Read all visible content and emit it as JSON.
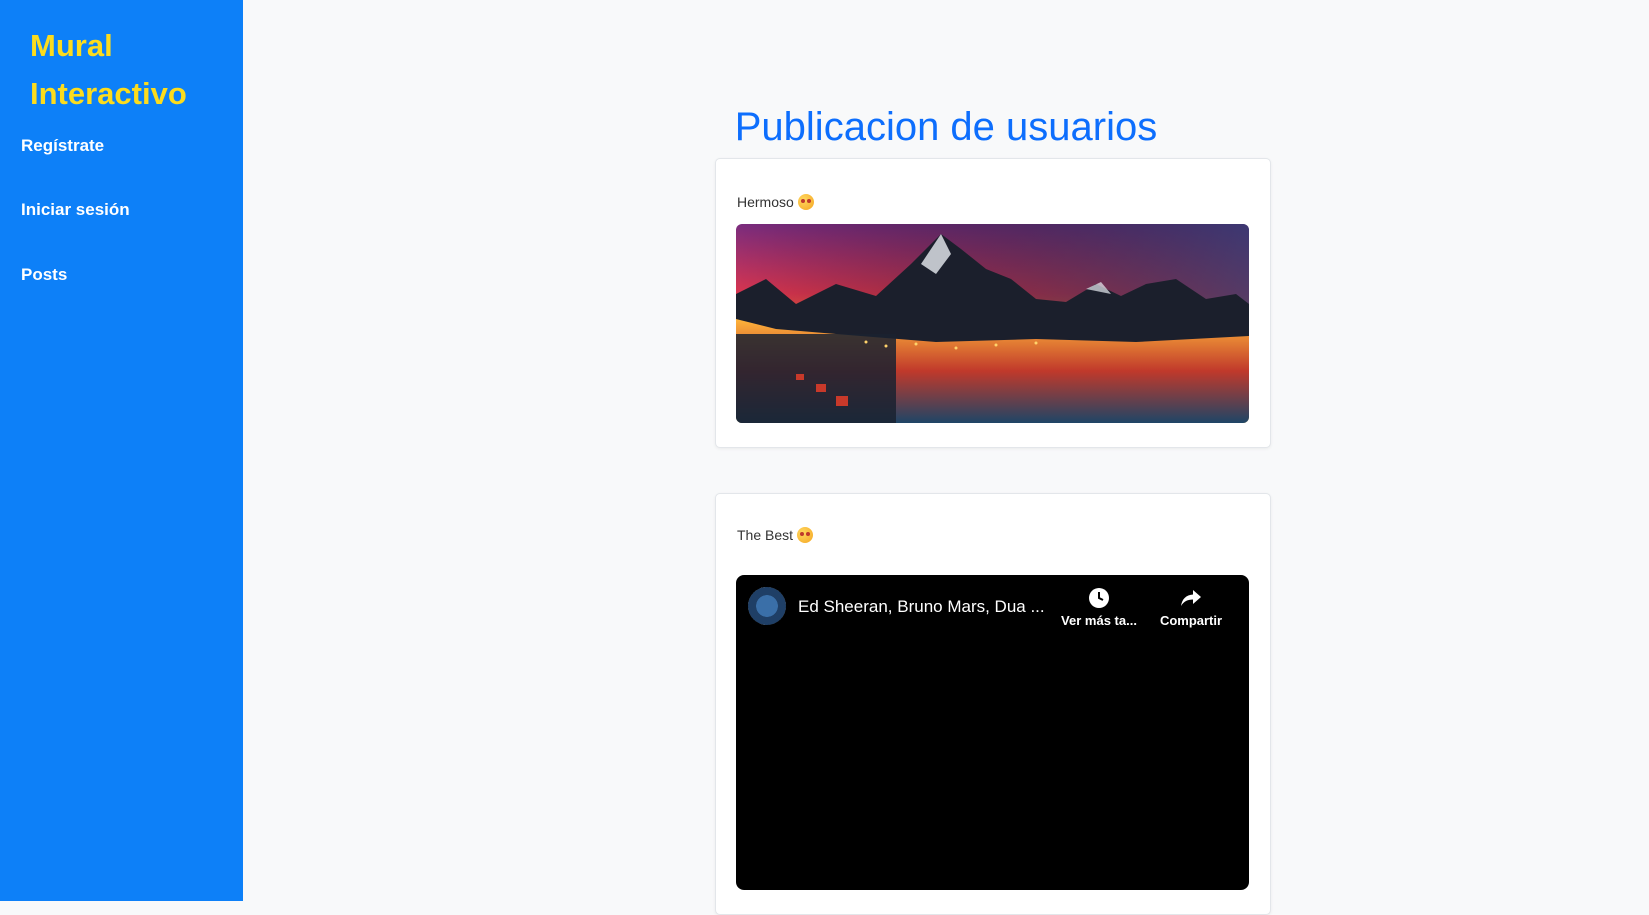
{
  "sidebar": {
    "brand_line1": "Mural",
    "brand_line2": "Interactivo",
    "items": [
      {
        "label": "Regístrate"
      },
      {
        "label": "Iniciar sesión"
      },
      {
        "label": "Posts"
      }
    ]
  },
  "main": {
    "title": "Publicacion de usuarios"
  },
  "posts": [
    {
      "text": "Hermoso",
      "emoji": "smiling-face-with-hearts",
      "media": "image"
    },
    {
      "text": "The Best",
      "emoji": "star-struck-face",
      "media": "video",
      "video": {
        "title": "Ed Sheeran, Bruno Mars, Dua ...",
        "watch_later_label": "Ver más ta...",
        "share_label": "Compartir"
      }
    }
  ],
  "colors": {
    "sidebar_bg": "#0d80f8",
    "brand": "#fcdc1d",
    "title": "#0d6efd",
    "page_bg": "#f8f9fa"
  }
}
